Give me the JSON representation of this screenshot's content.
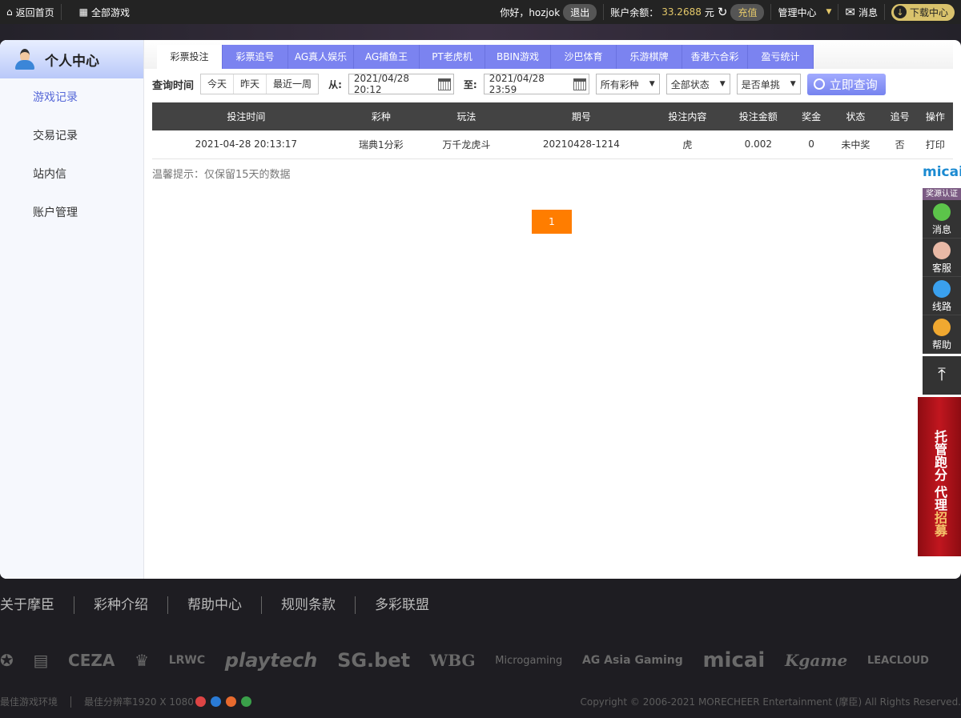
{
  "topbar": {
    "home": "返回首页",
    "all_games": "全部游戏",
    "greeting": "你好，hozjok",
    "logout": "退出",
    "balance_label": "账户余额：",
    "balance": "33.2688",
    "currency": "元",
    "recharge": "充值",
    "manage": "管理中心",
    "messages": "消息",
    "download": "下载中心"
  },
  "sidebar": {
    "title": "个人中心",
    "items": [
      {
        "label": "游戏记录"
      },
      {
        "label": "交易记录"
      },
      {
        "label": "站内信"
      },
      {
        "label": "账户管理"
      }
    ]
  },
  "tabs": [
    "彩票投注",
    "彩票追号",
    "AG真人娱乐",
    "AG捕鱼王",
    "PT老虎机",
    "BBIN游戏",
    "沙巴体育",
    "乐游棋牌",
    "香港六合彩",
    "盈亏统计"
  ],
  "filters": {
    "label": "查询时间",
    "quick": [
      "今天",
      "昨天",
      "最近一周"
    ],
    "from_label": "从:",
    "from": "2021/04/28 20:12",
    "to_label": "至:",
    "to": "2021/04/28 23:59",
    "lottery": "所有彩种",
    "status": "全部状态",
    "single": "是否单挑",
    "query": "立即查询"
  },
  "table": {
    "headers": [
      "投注时间",
      "彩种",
      "玩法",
      "期号",
      "投注内容",
      "投注金额",
      "奖金",
      "状态",
      "追号",
      "操作"
    ],
    "rows": [
      [
        "2021-04-28 20:13:17",
        "瑞典1分彩",
        "万千龙虎斗",
        "20210428-1214",
        "虎",
        "0.002",
        "0",
        "未中奖",
        "否",
        "打印"
      ]
    ]
  },
  "tip": "温馨提示：仅保留15天的数据",
  "pagination": {
    "current": "1"
  },
  "rightbar": {
    "logo": "micai",
    "cert": "奖源认证",
    "items": [
      "消息",
      "客服",
      "线路",
      "帮助"
    ],
    "banner1": "托管跑分",
    "banner2a": "代理",
    "banner2b": "招募"
  },
  "footer": {
    "links": [
      "关于摩臣",
      "彩种介绍",
      "帮助中心",
      "规则条款",
      "多彩联盟"
    ],
    "logos": [
      "CEZA",
      "LRWC",
      "playtech",
      "SG.bet",
      "WBG",
      "Microgaming",
      "AG Asia Gaming",
      "micai",
      "Kgame",
      "LEACLOUD"
    ],
    "env": "最佳游戏环境",
    "resolution": "最佳分辨率1920 X 1080",
    "copyright": "Copyright © 2006-2021 MORECHEER Entertainment (摩臣) All Rights Reserved."
  },
  "colors": {
    "accent": "#7b83f0",
    "page_btn": "#ff7d00"
  }
}
